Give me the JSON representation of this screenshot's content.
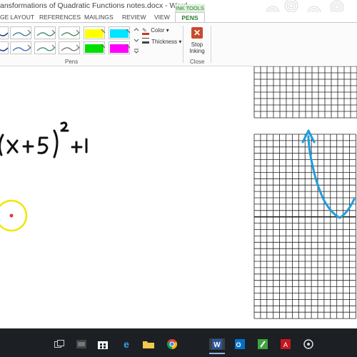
{
  "window": {
    "title": "ansformations of Quadratic Functions notes.docx - Word"
  },
  "ribbon": {
    "contextual_group": "INK TOOLS",
    "tabs": [
      "GE LAYOUT",
      "REFERENCES",
      "MAILINGS",
      "REVIEW",
      "VIEW"
    ],
    "active_tab": "PENS",
    "pens_group_label": "Pens",
    "color_label": "Color",
    "thickness_label": "Thickness",
    "close_group_label": "Close",
    "stop_inking_line1": "Stop",
    "stop_inking_line2": "Inking",
    "pen_colors": {
      "row1": [
        "#1a3f8b",
        "#2f6d87",
        "#2f7d5a",
        "#357e4e",
        "#ffff00",
        "#00e5ff"
      ],
      "row2": [
        "#1a3f8b",
        "#2d5fa8",
        "#2e8b57",
        "#6a6a6a",
        "#00e000",
        "#ff00ff"
      ]
    }
  },
  "document": {
    "equation": "(x+5)² + 1",
    "ink_color": "#1f9dd9",
    "highlight_circle_color": "#f2e600",
    "point_color": "#e53935"
  },
  "taskbar": {
    "icons": [
      "task-view",
      "store",
      "edge",
      "files",
      "chrome",
      "word",
      "outlook",
      "green-app",
      "acrobat",
      "obs"
    ],
    "active": "word"
  }
}
